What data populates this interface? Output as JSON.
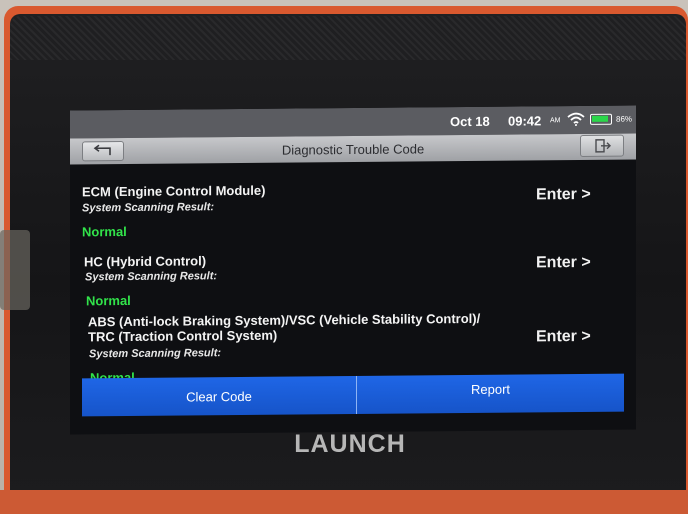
{
  "status_bar": {
    "date": "Oct 18",
    "time": "09:42",
    "ampm": "AM",
    "battery": "86%"
  },
  "header": {
    "title": "Diagnostic Trouble Code",
    "back_icon": "back-arrow-icon",
    "exit_icon": "exit-icon"
  },
  "systems": [
    {
      "name": "ECM (Engine Control Module)",
      "scan_label": "System Scanning Result:",
      "status": "Normal",
      "enter_label": "Enter >"
    },
    {
      "name": "HC (Hybrid Control)",
      "scan_label": "System Scanning Result:",
      "status": "Normal",
      "enter_label": "Enter >"
    },
    {
      "name": "ABS (Anti-lock Braking System)/VSC (Vehicle Stability Control)/ TRC (Traction Control System)",
      "scan_label": "System Scanning Result:",
      "status": "Normal",
      "enter_label": "Enter >"
    }
  ],
  "actions": {
    "clear_label": "Clear Code",
    "report_label": "Report"
  },
  "brand": "LAUNCH",
  "colors": {
    "status_normal": "#31e24a",
    "action_blue": "#1f66e6",
    "device_case": "#d9592f"
  }
}
